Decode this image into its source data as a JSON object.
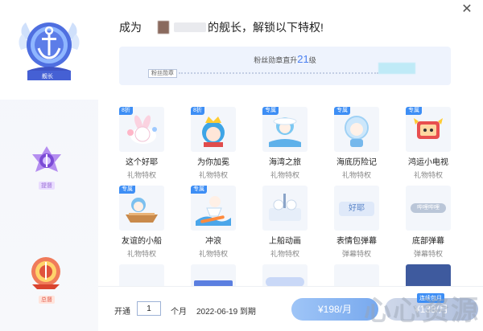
{
  "header": {
    "prefix": "成为",
    "suffix": "的舰长，解锁以下特权!"
  },
  "medal": {
    "title_prefix": "粉丝勋章直升",
    "level": "21",
    "title_suffix": "级",
    "chip_label": "粉丝勋章"
  },
  "rail": {
    "items": [
      {
        "label": "舰长"
      },
      {
        "label": "提督"
      },
      {
        "label": "总督"
      }
    ]
  },
  "privileges": [
    {
      "name": "这个好耶",
      "sub": "礼物特权",
      "tag": "8折"
    },
    {
      "name": "为你加冕",
      "sub": "礼物特权",
      "tag": "8折"
    },
    {
      "name": "海湾之旅",
      "sub": "礼物特权",
      "tag": "专属"
    },
    {
      "name": "海底历险记",
      "sub": "礼物特权",
      "tag": "专属"
    },
    {
      "name": "鸿运小电视",
      "sub": "礼物特权",
      "tag": "专属"
    },
    {
      "name": "友谊的小船",
      "sub": "礼物特权",
      "tag": "专属"
    },
    {
      "name": "冲浪",
      "sub": "礼物特权",
      "tag": "专属"
    },
    {
      "name": "上船动画",
      "sub": "礼物特权",
      "tag": ""
    },
    {
      "name": "表情包弹幕",
      "sub": "弹幕特权",
      "tag": ""
    },
    {
      "name": "底部弹幕",
      "sub": "弹幕特权",
      "tag": ""
    }
  ],
  "thumb_text": {
    "haoye": "好耶",
    "bottom": "哔哩哔哩"
  },
  "footer": {
    "open_label": "开通",
    "months_value": "1",
    "month_unit": "个月",
    "expiry": "2022-06-19 到期",
    "buy_label": "¥198/月",
    "renew_label": "¥138/月",
    "renew_tag": "连续包月"
  },
  "colors": {
    "accent": "#4a7ff0",
    "tag_blue": "#3d8ef5",
    "rail_bg": "#f4f6fb"
  },
  "watermark_text": "心心资源"
}
